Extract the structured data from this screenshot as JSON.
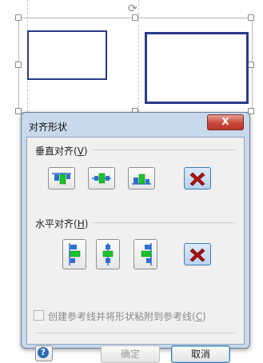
{
  "canvas": {
    "rotate_glyph": "⟳"
  },
  "dialog": {
    "title": "对齐形状",
    "close_label": "X",
    "vertical_group": {
      "label": "垂直对齐(",
      "access_key": "V",
      "label_end": ")"
    },
    "horizontal_group": {
      "label": "水平对齐(",
      "access_key": "H",
      "label_end": ")"
    },
    "glue_checkbox": {
      "label": "创建参考线并将形状粘附到参考线(",
      "access_key": "C",
      "label_end": ")",
      "checked": false,
      "enabled": false
    },
    "help_label": "?",
    "ok_label": "确定",
    "cancel_label": "取消"
  },
  "icons": {
    "vertical": [
      "align-top-icon",
      "align-middle-icon",
      "align-bottom-icon",
      "no-align-icon"
    ],
    "horizontal": [
      "align-left-icon",
      "align-center-icon",
      "align-right-icon",
      "no-align-icon"
    ]
  },
  "colors": {
    "shape_border": "#2b3a8a",
    "icon_blue": "#2f6fd1",
    "icon_green": "#17c42c",
    "no_align_red": "#b01010"
  }
}
